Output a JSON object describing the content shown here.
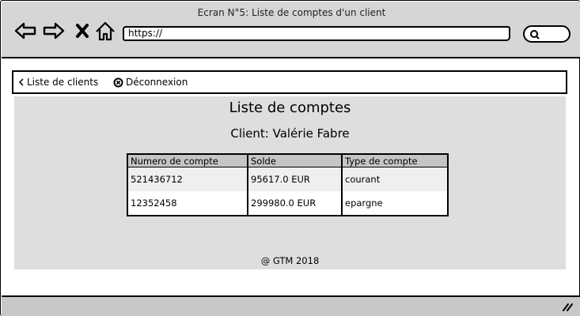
{
  "window": {
    "title": "Ecran N°5: Liste de comptes d'un client"
  },
  "browser": {
    "url": "https://",
    "icons": [
      "back-arrow-icon",
      "forward-arrow-icon",
      "close-icon",
      "home-icon",
      "search-icon"
    ]
  },
  "nav": {
    "back_label": "Liste de clients",
    "logout_label": "Déconnexion"
  },
  "main": {
    "title": "Liste de comptes",
    "client_label": "Client: Valérie Fabre",
    "table": {
      "headers": [
        "Numero de compte",
        "Solde",
        "Type de compte"
      ],
      "rows": [
        [
          "521436712",
          "95617.0 EUR",
          "courant"
        ],
        [
          "12352458",
          "299980.0 EUR",
          "epargne"
        ]
      ]
    },
    "footer": "@ GTM 2018"
  },
  "colors": {
    "chrome": "#d6d6d6",
    "content_bg": "#dedede",
    "header_bg": "#c5c5c5"
  }
}
